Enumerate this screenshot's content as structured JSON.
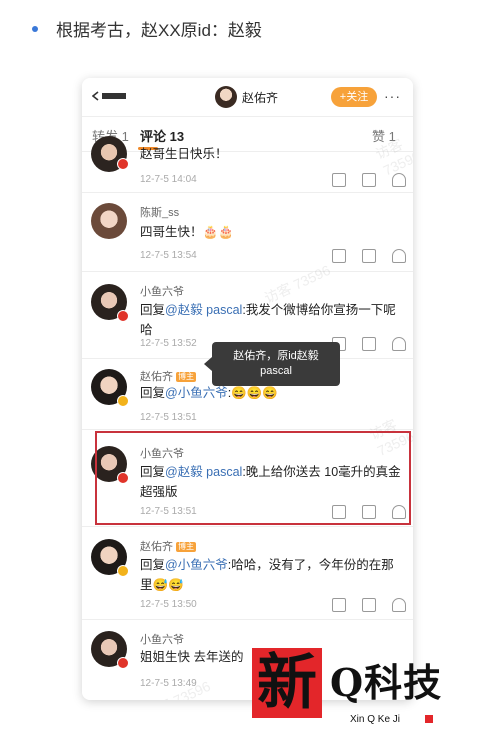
{
  "caption": {
    "text": "根据考古，赵XX原id：赵毅"
  },
  "topbar": {
    "user_name": "赵佑齐",
    "follow_label": "+关注",
    "more_label": "···"
  },
  "tabs": {
    "repost": "转发 1",
    "comment": "评论 13",
    "like": "赞 1"
  },
  "comments": [
    {
      "name": "",
      "text_plain": "赵哥生日快乐！",
      "time": "12-7-5 14:04"
    },
    {
      "name": "陈斯_ss",
      "text_plain": "四哥生快！🎂🎂",
      "time": "12-7-5 13:54"
    },
    {
      "name": "小鱼六爷",
      "reply_prefix": "回复",
      "mention": "@赵毅 pascal",
      "text_after": ":我发个微博给你宣扬一下呢哈",
      "time": "12-7-5 13:52"
    },
    {
      "name": "赵佑齐",
      "tag": "博主",
      "reply_prefix": "回复",
      "mention": "@小鱼六爷",
      "text_after": ":😄😄😄",
      "time": "12-7-5 13:51"
    },
    {
      "name": "小鱼六爷",
      "reply_prefix": "回复",
      "mention": "@赵毅 pascal",
      "text_after": ":晚上给你送去 10毫升的真金 超强版",
      "time": "12-7-5 13:51"
    },
    {
      "name": "赵佑齐",
      "tag": "博主",
      "reply_prefix": "回复",
      "mention": "@小鱼六爷",
      "text_after": ":哈哈，没有了，今年份的在那里😅😅",
      "time": "12-7-5 13:50"
    },
    {
      "name": "小鱼六爷",
      "text_plain": "姐姐生快 去年送的",
      "time": "12-7-5 13:49"
    }
  ],
  "tooltip": {
    "line1": "赵佑齐，原id赵毅",
    "line2": "pascal"
  },
  "watermark": {
    "text": "访客 73596"
  },
  "logo": {
    "seal_char": "新",
    "main_text": "Q科技",
    "sub_text": "Xin Q Ke Ji"
  },
  "colors": {
    "accent": "#f7a23a",
    "highlight": "#c8323c",
    "mention": "#3a6fb4"
  }
}
